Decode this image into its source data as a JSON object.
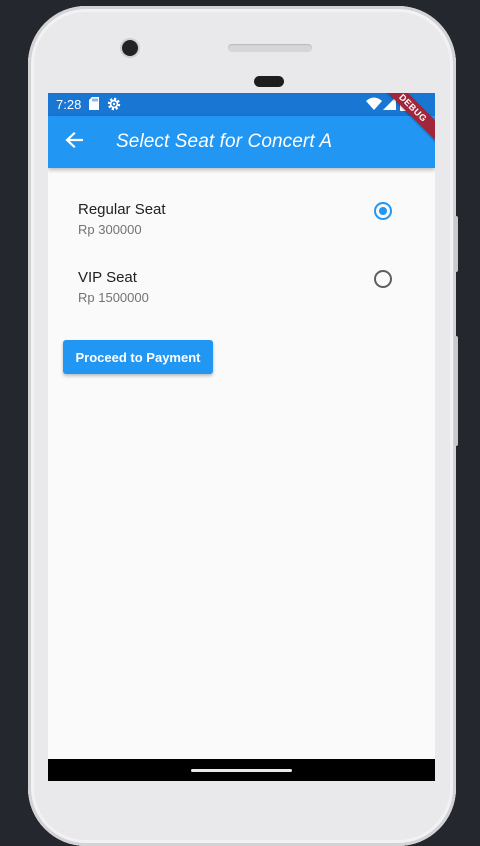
{
  "status_bar": {
    "time": "7:28",
    "icons": [
      "sd-card-icon",
      "settings-icon",
      "wifi-icon",
      "cell-signal-icon",
      "battery-icon"
    ]
  },
  "debug_banner": "DEBUG",
  "app_bar": {
    "back_icon": "arrow-back-icon",
    "title": "Select Seat for Concert A"
  },
  "seats": [
    {
      "title": "Regular Seat",
      "price": "Rp 300000",
      "selected": true
    },
    {
      "title": "VIP Seat",
      "price": "Rp 1500000",
      "selected": false
    }
  ],
  "proceed_button": "Proceed to Payment",
  "colors": {
    "primary": "#2196f3",
    "status_bar": "#1976d2",
    "background": "#fafafa",
    "debug_banner": "#a0263b"
  }
}
